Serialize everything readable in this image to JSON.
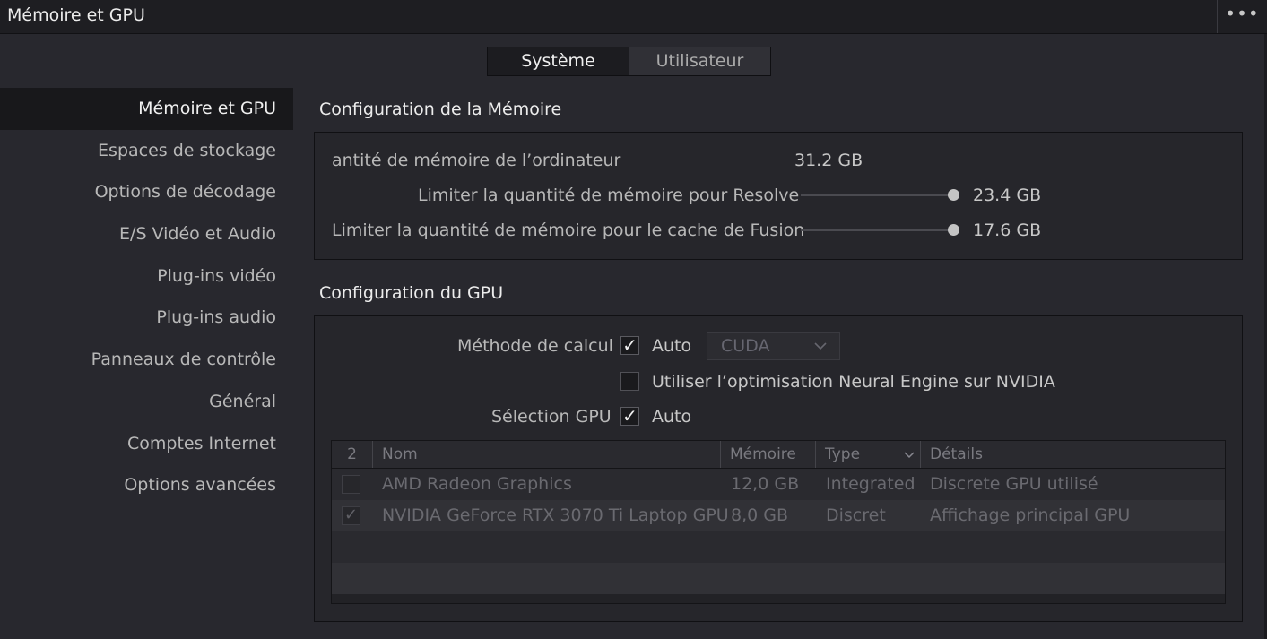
{
  "header": {
    "title": "Mémoire et GPU",
    "menu_label": "•••"
  },
  "tabs": [
    {
      "label": "Système",
      "active": true
    },
    {
      "label": "Utilisateur",
      "active": false
    }
  ],
  "sidebar": {
    "items": [
      {
        "label": "Mémoire et GPU",
        "active": true
      },
      {
        "label": "Espaces de stockage"
      },
      {
        "label": "Options de décodage"
      },
      {
        "label": "E/S Vidéo et Audio"
      },
      {
        "label": "Plug-ins vidéo"
      },
      {
        "label": "Plug-ins audio"
      },
      {
        "label": "Panneaux de contrôle"
      },
      {
        "label": "Général"
      },
      {
        "label": "Comptes Internet"
      },
      {
        "label": "Options avancées"
      }
    ]
  },
  "memory": {
    "title": "Configuration de la Mémoire",
    "total_label": "antité de mémoire de l’ordinateur",
    "total_value": "31.2 GB",
    "resolve_label": "Limiter la quantité de mémoire pour Resolve",
    "resolve_value": "23.4 GB",
    "resolve_fraction": 1.0,
    "fusion_label": "Limiter la quantité de mémoire pour le cache de Fusion",
    "fusion_value": "17.6 GB",
    "fusion_fraction": 1.0
  },
  "gpu": {
    "title": "Configuration du GPU",
    "method_label": "Méthode de calcul",
    "method_auto_label": "Auto",
    "method_auto_checked": "✓",
    "method_dropdown_value": "CUDA",
    "neural_label": "Utiliser l’optimisation Neural Engine sur NVIDIA",
    "neural_checked": "",
    "selection_label": "Sélection GPU",
    "selection_auto_label": "Auto",
    "selection_auto_checked": "✓",
    "table": {
      "count": "2",
      "columns": {
        "name": "Nom",
        "memory": "Mémoire",
        "type": "Type",
        "details": "Détails"
      },
      "rows": [
        {
          "checked": "",
          "name": "AMD Radeon Graphics",
          "memory": "12,0 GB",
          "type": "Integrated",
          "details": "Discrete GPU utilisé"
        },
        {
          "checked": "✓",
          "name": "NVIDIA GeForce RTX 3070 Ti Laptop GPU",
          "memory": "8,0 GB",
          "type": "Discret",
          "details": "Affichage principal GPU"
        }
      ]
    }
  },
  "icons": {
    "more": "more-options-icon",
    "chevron": "chevron-down-icon",
    "check": "checkmark-icon"
  }
}
